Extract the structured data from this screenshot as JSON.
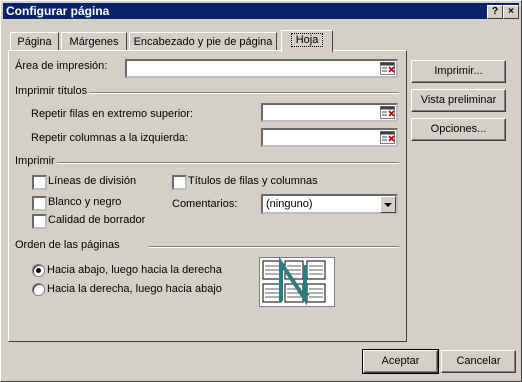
{
  "window": {
    "title": "Configurar página",
    "help_glyph": "?",
    "close_glyph": "×"
  },
  "tabs": [
    {
      "label": "Página"
    },
    {
      "label": "Márgenes"
    },
    {
      "label": "Encabezado y pie de página"
    },
    {
      "label": "Hoja",
      "active": true
    }
  ],
  "print_area": {
    "label": "Área de impresión:",
    "value": ""
  },
  "print_titles": {
    "heading": "Imprimir títulos",
    "rows_label": "Repetir filas en extremo superior:",
    "rows_value": "",
    "cols_label": "Repetir columnas a la izquierda:",
    "cols_value": ""
  },
  "print": {
    "heading": "Imprimir",
    "gridlines": {
      "label": "Líneas de división",
      "checked": false
    },
    "black_white": {
      "label": "Blanco y negro",
      "checked": false
    },
    "draft": {
      "label": "Calidad de borrador",
      "checked": false
    },
    "row_col_headings": {
      "label": "Títulos de filas y columnas",
      "checked": false
    },
    "comments_label": "Comentarios:",
    "comments_value": "(ninguno)"
  },
  "page_order": {
    "heading": "Orden de las páginas",
    "down_then_over": {
      "label": "Hacia abajo, luego hacia la derecha",
      "selected": true
    },
    "over_then_down": {
      "label": "Hacia la derecha, luego hacia abajo",
      "selected": false
    }
  },
  "side_buttons": {
    "print": "Imprimir...",
    "preview": "Vista preliminar",
    "options": "Opciones..."
  },
  "footer_buttons": {
    "ok": "Aceptar",
    "cancel": "Cancelar"
  },
  "colors": {
    "titlebar": "#0a246a",
    "face": "#d4d0c8",
    "order_arrow": "#2e7d7d"
  }
}
